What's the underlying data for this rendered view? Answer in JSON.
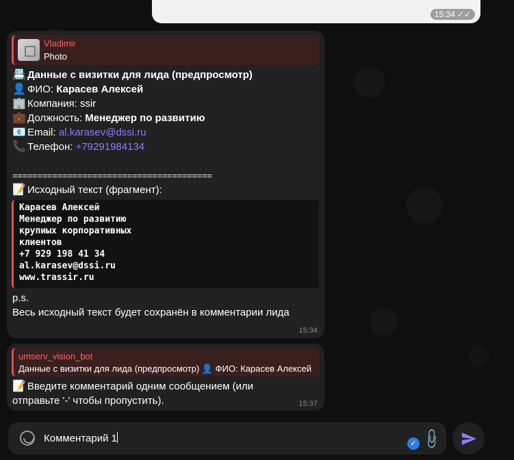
{
  "outgoing": {
    "time": "15:34",
    "checks": "✓✓"
  },
  "msg1": {
    "reply": {
      "name": "Vladimir",
      "text": "Photo"
    },
    "lines": {
      "header": "Данные с визитки для лида (предпросмотр)",
      "fio_label": "ФИО: ",
      "fio_value": "Карасев Алексей",
      "company_label": "Компания: ssir",
      "position_label": "Должность: ",
      "position_value": "Менеджер по развитию",
      "email_label": "Email: ",
      "email_value": "al.karasev@dssi.ru",
      "phone_label": "Телефон: ",
      "phone_value": "+79291984134",
      "separator": "========================================",
      "source_header": "Исходный текст (фрагмент):"
    },
    "code_lines": [
      "Карасев Алексей",
      "Менеджер по развитию",
      "крупиых корпоративных",
      "клиентов",
      "+7 929 198 41 34",
      "al.karasev@dssi.ru",
      "www.trassir.ru"
    ],
    "ps1": "p.s.",
    "ps2": "Весь исходный текст будет сохранён в комментарии лида",
    "time": "15:34"
  },
  "msg2": {
    "reply": {
      "name": "umserv_vision_bot",
      "text": "Данные с визитки для лида (предпросмотр) 👤 ФИО: Карасев Алексей"
    },
    "line1": "Введите комментарий одним сообщением (или",
    "line2": "отправьте '-' чтобы пропустить).",
    "time": "15:37"
  },
  "composer": {
    "value": "Комментарий 1",
    "badge": "✓"
  },
  "icons": {
    "card": "📇",
    "person": "👤",
    "building": "🏢",
    "briefcase": "💼",
    "email": "📧",
    "phone": "📞",
    "memo": "📝"
  }
}
